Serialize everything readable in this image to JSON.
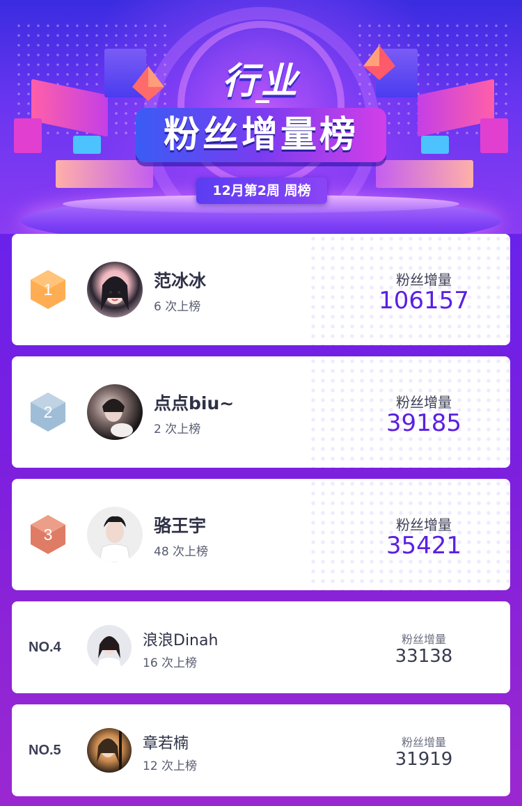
{
  "banner": {
    "title_line1": "行业",
    "title_line2": "粉丝增量榜",
    "week_label": "12月第2周 周榜"
  },
  "colors": {
    "rank1": "#ffa94d",
    "rank2": "#a8c3db",
    "rank3": "#e2836d",
    "value_accent": "#5a1fe0"
  },
  "entries": [
    {
      "rank": "1",
      "name": "范冰冰",
      "times": "6 次上榜",
      "stat_label": "粉丝增量",
      "value": "106157",
      "avatar": "avatar-fanbingbing"
    },
    {
      "rank": "2",
      "name": "点点biu~",
      "times": "2 次上榜",
      "stat_label": "粉丝增量",
      "value": "39185",
      "avatar": "avatar-diandian"
    },
    {
      "rank": "3",
      "name": "骆王宇",
      "times": "48 次上榜",
      "stat_label": "粉丝增量",
      "value": "35421",
      "avatar": "avatar-luowangyu"
    },
    {
      "rank": "NO.4",
      "name": "浪浪Dinah",
      "times": "16 次上榜",
      "stat_label": "粉丝增量",
      "value": "33138",
      "avatar": "avatar-langlang"
    },
    {
      "rank": "NO.5",
      "name": "章若楠",
      "times": "12 次上榜",
      "stat_label": "粉丝增量",
      "value": "31919",
      "avatar": "avatar-zhangruonan"
    }
  ]
}
